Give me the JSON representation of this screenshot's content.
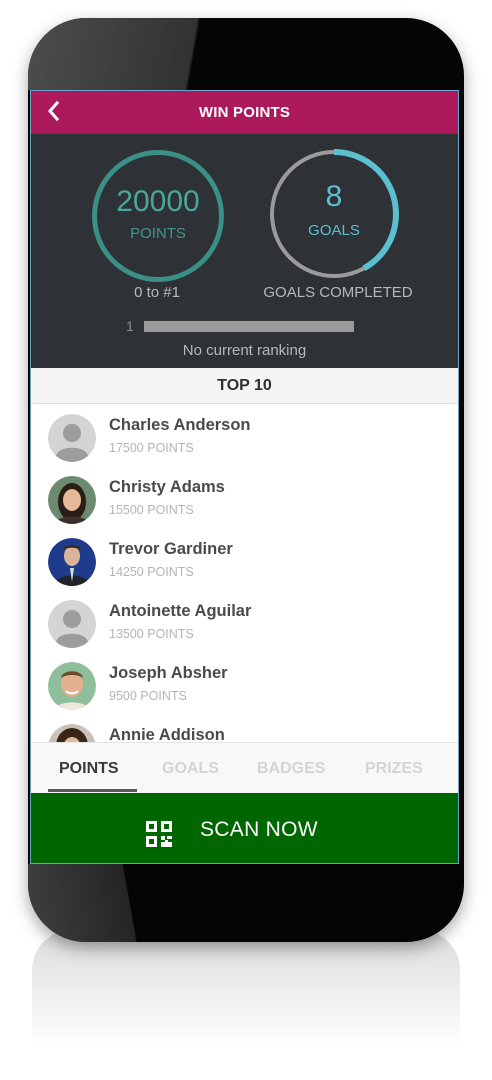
{
  "header": {
    "title": "WIN POINTS",
    "back_icon": "chevron-left-icon"
  },
  "stats": {
    "points_value": "20000",
    "points_label": "POINTS",
    "rank_caption": "0 to #1",
    "goals_value": "8",
    "goals_label": "GOALS",
    "goals_caption": "GOALS COMPLETED",
    "goals_ring_progress": 0.42,
    "rank_number": "1",
    "rank_text": "No current ranking"
  },
  "top10": {
    "title": "TOP 10",
    "entries": [
      {
        "name": "Charles Anderson",
        "points": "17500 POINTS",
        "avatar": "default-avatar"
      },
      {
        "name": "Christy Adams",
        "points": "15500 POINTS",
        "avatar": "photo-avatar"
      },
      {
        "name": "Trevor Gardiner",
        "points": "14250 POINTS",
        "avatar": "photo-avatar"
      },
      {
        "name": "Antoinette Aguilar",
        "points": "13500 POINTS",
        "avatar": "default-avatar"
      },
      {
        "name": "Joseph Absher",
        "points": "9500 POINTS",
        "avatar": "photo-avatar"
      },
      {
        "name": "Annie Addison",
        "points": "",
        "avatar": "photo-avatar"
      }
    ]
  },
  "tabs": [
    "POINTS",
    "GOALS",
    "BADGES",
    "PRIZES"
  ],
  "active_tab": "POINTS",
  "scan": {
    "label": "SCAN NOW",
    "icon": "qr-code-icon"
  },
  "colors": {
    "header": "#ad1a5b",
    "panel": "#2e3237",
    "points_ring": "#3a8f86",
    "goals_ring": "#5bbfd0",
    "scan_button": "#006600"
  }
}
